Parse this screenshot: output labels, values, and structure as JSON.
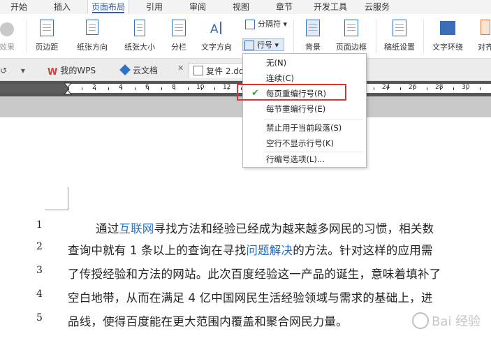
{
  "ribbon_tabs": [
    "开始",
    "插入",
    "页面布局",
    "引用",
    "审阅",
    "视图",
    "章节",
    "开发工具",
    "云服务"
  ],
  "active_tab": "页面布局",
  "ribbon_buttons": {
    "effects": "效果",
    "margins": "页边距",
    "orientation": "纸张方向",
    "size": "纸张大小",
    "columns": "分栏",
    "text_direction": "文字方向",
    "separator": "分隔符",
    "line_numbers": "行号",
    "background": "背景",
    "page_border": "页面边框",
    "manuscript": "稿纸设置",
    "text_wrap": "文字环绕",
    "align": "对齐"
  },
  "doc_tabs": {
    "wps": "我的WPS",
    "cloud": "云文档",
    "current": "复件 2.doc"
  },
  "ruler_numbers": [
    "2",
    "4",
    "6",
    "8",
    "10",
    "12",
    "14",
    "16",
    "18",
    "20",
    "22",
    "24",
    "26",
    "28",
    "30"
  ],
  "line_number_menu": {
    "items": [
      {
        "label": "无(N)",
        "checked": false
      },
      {
        "label": "连续(C)",
        "checked": false
      },
      {
        "label": "每页重编行号(R)",
        "checked": true
      },
      {
        "label": "每节重编行号(E)",
        "checked": false
      },
      {
        "label": "禁止用于当前段落(S)",
        "checked": false
      },
      {
        "label": "空行不显示行号(K)",
        "checked": false
      },
      {
        "label": "行编号选项(L)...",
        "checked": false
      }
    ]
  },
  "document_lines": [
    {
      "number": "1",
      "parts": [
        {
          "t": "通过",
          "link": false
        },
        {
          "t": "互联网",
          "link": true
        },
        {
          "t": "寻找方法和经验已经成为越来越多网民的习惯，相关数",
          "link": false
        }
      ]
    },
    {
      "number": "2",
      "parts": [
        {
          "t": "查询中就有 1 条以上的查询在寻找",
          "link": false
        },
        {
          "t": "问题解决",
          "link": true
        },
        {
          "t": "的方法。针对这样的应用需",
          "link": false
        }
      ]
    },
    {
      "number": "3",
      "parts": [
        {
          "t": "了传授经验和方法的网站。此次百度经验这一产品的诞生，意味着填补了",
          "link": false
        }
      ]
    },
    {
      "number": "4",
      "parts": [
        {
          "t": "空白地带，从而在满足 4 亿中国网民生活经验领域与需求的基础上，进",
          "link": false
        }
      ]
    },
    {
      "number": "5",
      "parts": [
        {
          "t": "品线，使得百度能在更大范围内覆盖和聚合网民力量。",
          "link": false
        }
      ]
    }
  ],
  "watermark_text": "Bai 经验",
  "colors": {
    "accent": "#2b62b6",
    "link": "#2b6fbf",
    "check": "#3a9b3a",
    "highlight": "#e03030"
  }
}
